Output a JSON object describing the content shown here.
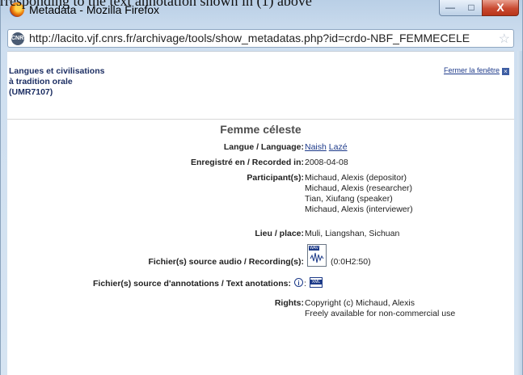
{
  "caption": "rresponding to the text annotation shown in (1) above",
  "window": {
    "title": "Metadata - Mozilla Firefox",
    "min_label": "—",
    "max_label": "□",
    "close_label": "X"
  },
  "addressbar": {
    "url": "http://lacito.vjf.cnrs.fr/archivage/tools/show_metadatas.php?id=crdo-NBF_FEMMECELE",
    "site_icon_text": "CNRS"
  },
  "header": {
    "lab_line1": "Langues et civilisations",
    "lab_line2": "à tradition orale",
    "lab_line3": "(UMR7107)",
    "close_link": "Fermer la fenêtre",
    "close_x": "×"
  },
  "doc": {
    "title": "Femme céleste",
    "rows": {
      "langue_label": "Langue / Language:",
      "langue_values": [
        "Naish",
        "Lazé"
      ],
      "date_label": "Enregistré en / Recorded in:",
      "date_value": "2008-04-08",
      "participants_label": "Participant(s):",
      "participants": [
        "Michaud, Alexis (depositor)",
        "Michaud, Alexis (researcher)",
        "Tian, Xiufang (speaker)",
        "Michaud, Alexis (interviewer)"
      ],
      "lieu_label": "Lieu / place:",
      "lieu_value": "Muli, Liangshan, Sichuan",
      "audio_label": "Fichier(s) source audio / Recording(s):",
      "audio_duration": "(0:0H2:50)",
      "audio_icon_tag": "WAV",
      "annot_label": "Fichier(s) source d'annotations / Text anotations:",
      "annot_colon": ":",
      "info_glyph": "i",
      "xml_icon_tag": "XML",
      "rights_label": "Rights:",
      "rights_line1": "Copyright (c) Michaud, Alexis",
      "rights_line2": "Freely available for non-commercial use"
    }
  },
  "colors": {
    "frame": "#c7d9ec",
    "link": "#1d3a8a",
    "lab_text": "#1d2f63",
    "close_button": "#c94a31"
  }
}
